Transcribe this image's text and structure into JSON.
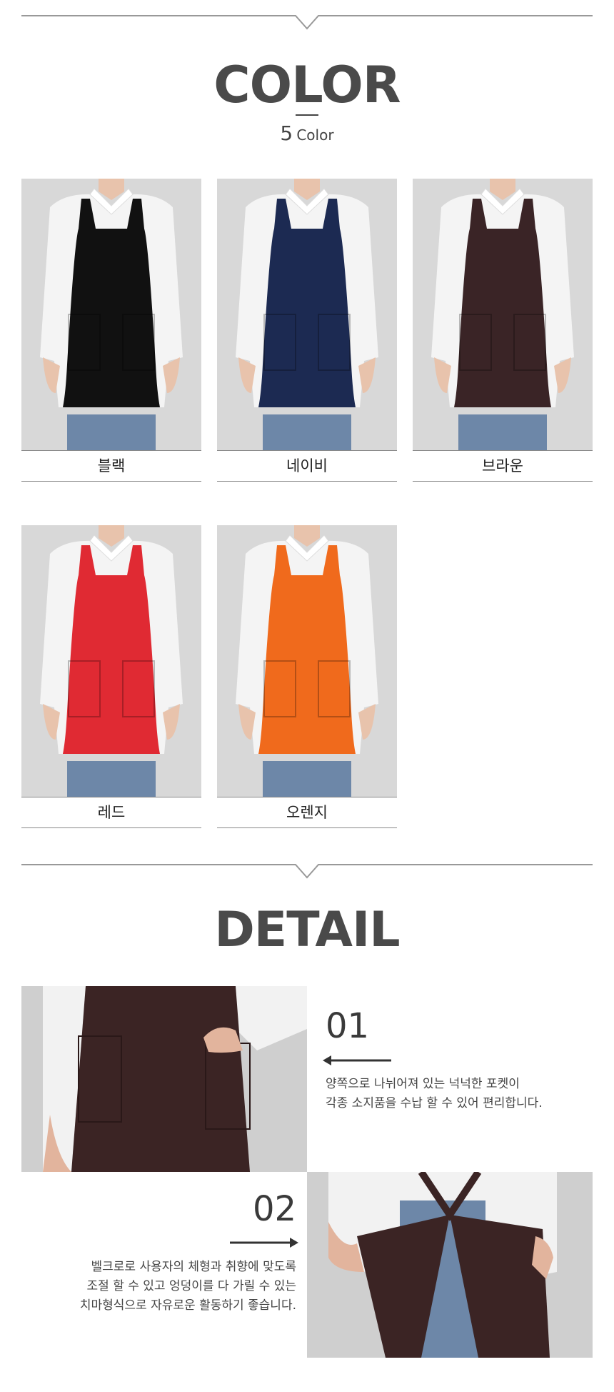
{
  "color_section": {
    "title": "COLOR",
    "count": "5",
    "count_label": "Color",
    "swatches": [
      {
        "label": "블랙",
        "apron_color": "#111111"
      },
      {
        "label": "네이비",
        "apron_color": "#1c2a52"
      },
      {
        "label": "브라운",
        "apron_color": "#3a2426"
      },
      {
        "label": "레드",
        "apron_color": "#e02a33"
      },
      {
        "label": "오렌지",
        "apron_color": "#f06a1c"
      }
    ]
  },
  "detail_section": {
    "title": "DETAIL",
    "items": [
      {
        "num": "01",
        "lines": [
          "양쪽으로 나뉘어져 있는 넉넉한 포켓이",
          "각종 소지품을 수납 할 수 있어 편리합니다."
        ]
      },
      {
        "num": "02",
        "lines": [
          "벨크로로 사용자의 체형과 취향에 맞도록",
          "조절 할 수 있고 엉덩이를 다 가릴 수 있는",
          "치마형식으로 자유로운 활동하기 좋습니다."
        ]
      }
    ]
  },
  "colors": {
    "shirt": "#f4f4f4",
    "jeans": "#6d87a8",
    "background_photo": "#d8d8d8",
    "detail_apron": "#3b2424"
  }
}
